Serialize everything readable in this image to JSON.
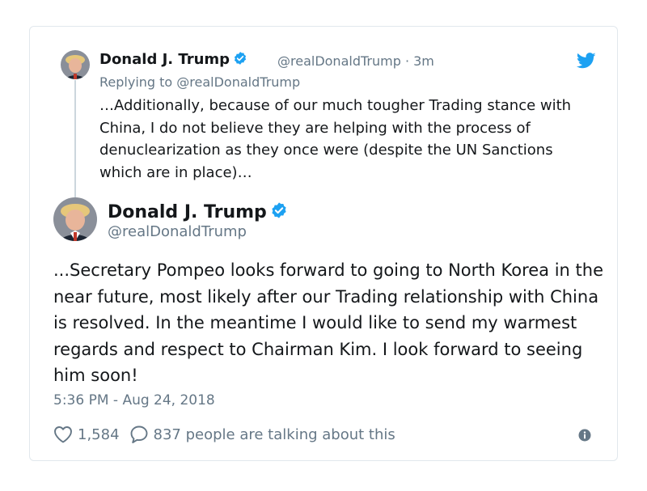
{
  "parent_tweet": {
    "name": "Donald J. Trump",
    "handle_time": "@realDonaldTrump · 3m",
    "replying_to": "Replying to @realDonaldTrump",
    "text": "…Additionally, because of our much tougher Trading stance with China, I do not believe they are helping with the process of denuclearization as they once were (despite the UN Sanctions which are in place)…"
  },
  "main_tweet": {
    "name": "Donald J. Trump",
    "handle": "@realDonaldTrump",
    "text": "...Secretary Pompeo looks forward to going to North Korea in the near future, most likely after our Trading relationship with China is resolved. In the meantime I would like to send my warmest regards and respect to Chairman Kim. I look forward to seeing him soon!",
    "timestamp": "5:36 PM - Aug 24, 2018",
    "likes": "1,584",
    "talking": "837 people are talking about this"
  },
  "icons": {
    "verified": "verified-badge-icon",
    "twitter": "twitter-bird-icon",
    "like": "heart-icon",
    "reply": "speech-bubble-icon",
    "info": "info-icon"
  },
  "colors": {
    "verified_blue": "#1da1f2",
    "secondary_text": "#657786",
    "primary_text": "#14171a",
    "border": "#e1e8ed"
  }
}
